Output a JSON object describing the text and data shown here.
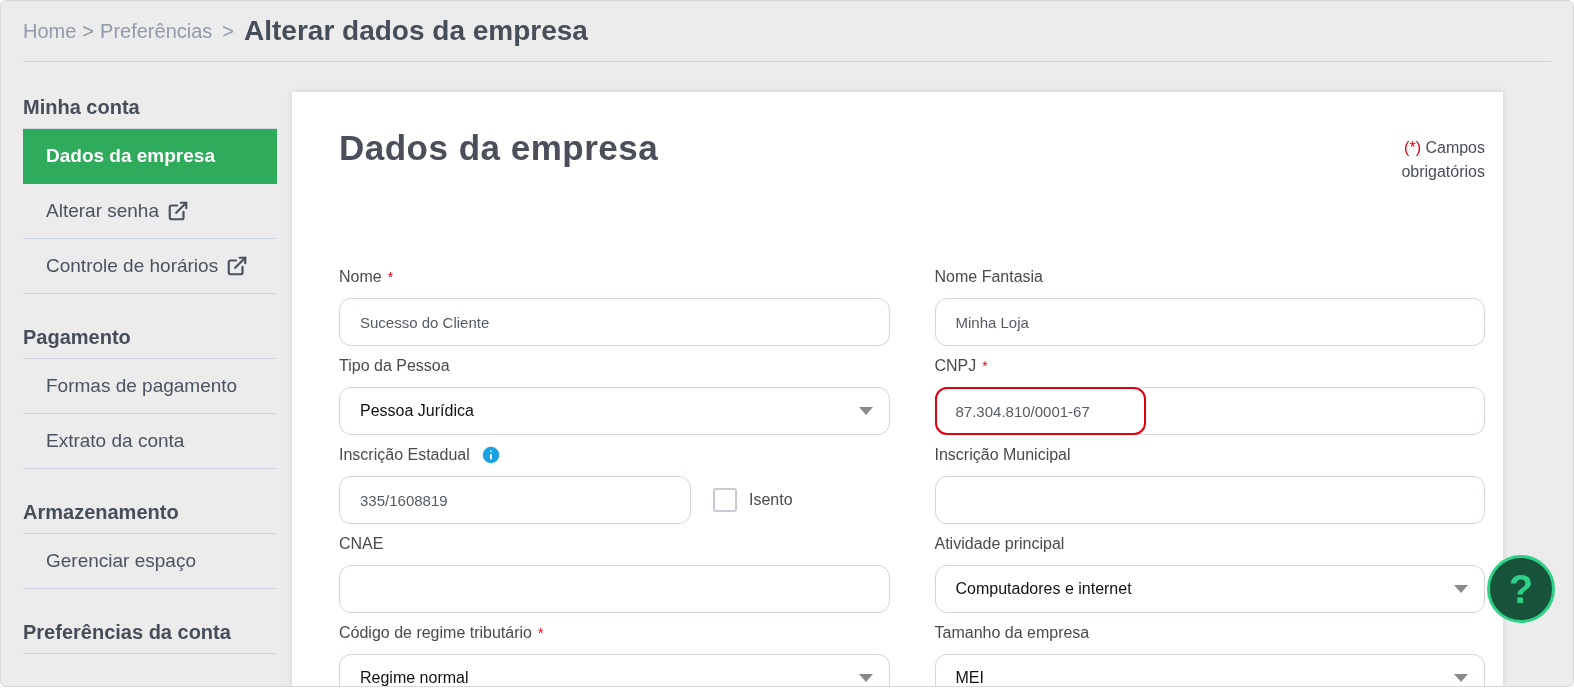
{
  "breadcrumb": {
    "items": [
      "Home",
      "Preferências"
    ],
    "separator": ">",
    "current": "Alterar dados da empresa"
  },
  "sidebar": {
    "sections": [
      {
        "heading": "Minha conta",
        "items": [
          {
            "label": "Dados da empresa",
            "selected": true,
            "external": false
          },
          {
            "label": "Alterar senha",
            "selected": false,
            "external": true
          },
          {
            "label": "Controle de horários",
            "selected": false,
            "external": true
          }
        ]
      },
      {
        "heading": "Pagamento",
        "items": [
          {
            "label": "Formas de pagamento",
            "selected": false,
            "external": false
          },
          {
            "label": "Extrato da conta",
            "selected": false,
            "external": false
          }
        ]
      },
      {
        "heading": "Armazenamento",
        "items": [
          {
            "label": "Gerenciar espaço",
            "selected": false,
            "external": false
          }
        ]
      },
      {
        "heading": "Preferências da conta"
      }
    ]
  },
  "form": {
    "title": "Dados da empresa",
    "required_note": {
      "mark": "(*)",
      "text": "Campos obrigatórios"
    },
    "fields": [
      {
        "kind": "text",
        "label": "Nome",
        "required_mark": "*",
        "value": "Sucesso do Cliente"
      },
      {
        "kind": "text",
        "label": "Nome Fantasia",
        "value": "Minha Loja"
      },
      {
        "kind": "select",
        "label": "Tipo da Pessoa",
        "value": "Pessoa Jurídica"
      },
      {
        "kind": "text",
        "label": "CNPJ",
        "required_mark": "*",
        "value": "87.304.810/0001-67",
        "highlighted": true
      },
      {
        "kind": "text_checkbox",
        "label": "Inscrição Estadual",
        "info": true,
        "value": "335/1608819",
        "checkbox": {
          "label": "Isento",
          "checked": false
        }
      },
      {
        "kind": "text",
        "label": "Inscrição Municipal"
      },
      {
        "kind": "text",
        "label": "CNAE"
      },
      {
        "kind": "select",
        "label": "Atividade principal",
        "value": "Computadores e internet"
      },
      {
        "kind": "select",
        "label": "Código de regime tributário",
        "required_mark": "*",
        "value": "Regime normal"
      },
      {
        "kind": "select",
        "label": "Tamanho da empresa",
        "value": "MEI"
      }
    ]
  },
  "help_button": {
    "label": "?"
  }
}
